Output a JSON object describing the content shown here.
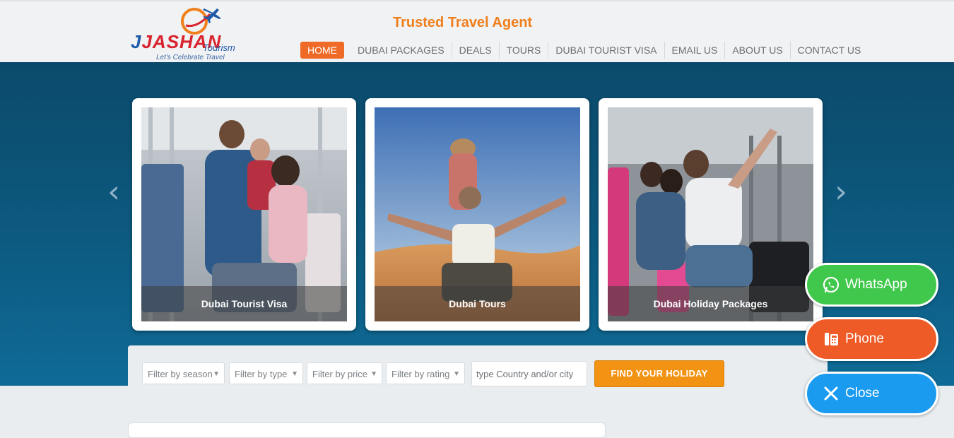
{
  "header": {
    "logo": {
      "brand": "JASHAN",
      "suffix": "Tourism",
      "tagline": "Let's Celebrate Travel"
    },
    "title": "Trusted Travel Agent",
    "nav": [
      {
        "label": "HOME",
        "active": true
      },
      {
        "label": "DUBAI PACKAGES"
      },
      {
        "label": "DEALS"
      },
      {
        "label": "TOURS"
      },
      {
        "label": "DUBAI TOURIST VISA"
      },
      {
        "label": "EMAIL US"
      },
      {
        "label": "ABOUT US"
      },
      {
        "label": "CONTACT US"
      }
    ]
  },
  "carousel": {
    "prev_icon": "chevron-left",
    "next_icon": "chevron-right",
    "cards": [
      {
        "caption": "Dubai Tourist Visa"
      },
      {
        "caption": "Dubai Tours"
      },
      {
        "caption": "Dubai Holiday Packages"
      }
    ]
  },
  "search": {
    "filters": [
      "Filter by season",
      "Filter by type",
      "Filter by price",
      "Filter by rating"
    ],
    "placeholder": "type Country and/or city",
    "button_label": "FIND YOUR HOLIDAY"
  },
  "floating": {
    "whatsapp_label": "WhatsApp",
    "phone_label": "Phone",
    "close_label": "Close"
  },
  "colors": {
    "accent_orange": "#ee6a26",
    "hero_blue": "#0d5a80",
    "whatsapp_green": "#3fc84b",
    "phone_orange": "#ef5b26",
    "close_blue": "#1b9bf0"
  }
}
